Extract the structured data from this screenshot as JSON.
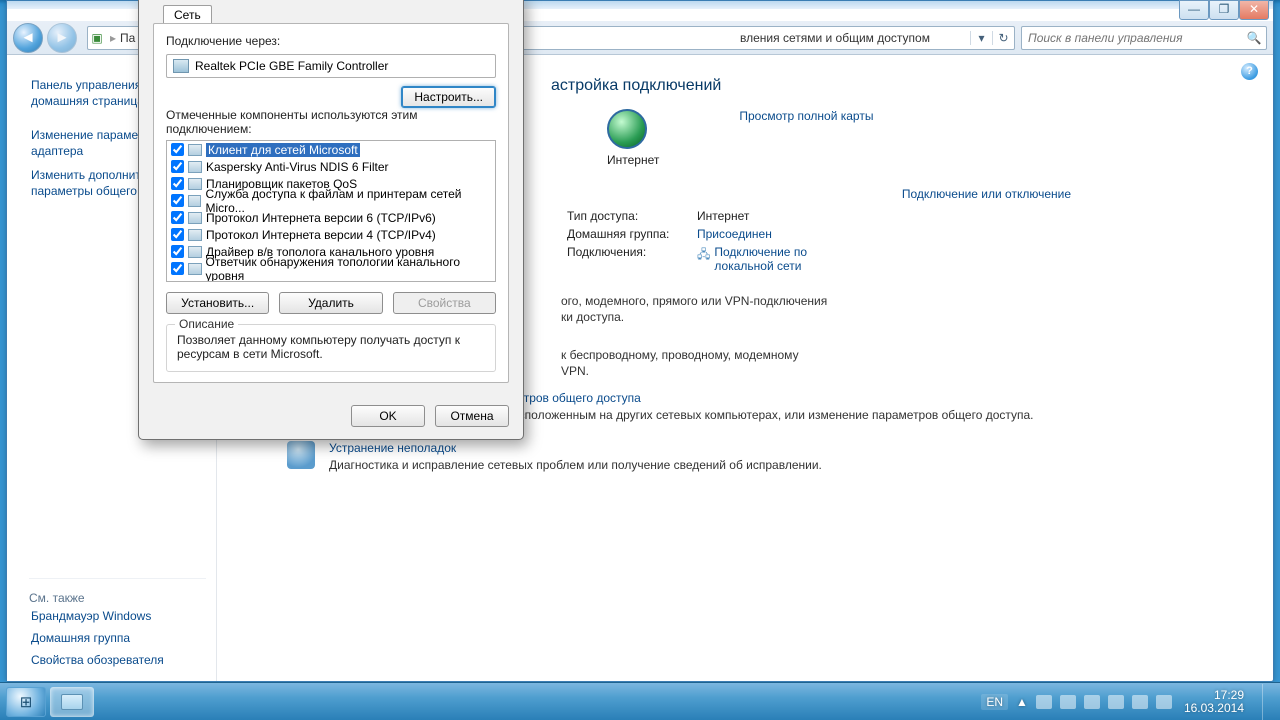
{
  "win_controls": {
    "min": "—",
    "max": "❐",
    "close": "✕"
  },
  "addr": {
    "prefix": "Па",
    "trail": "вления сетями и общим доступом",
    "search_placeholder": "Поиск в панели управления"
  },
  "sidebar": {
    "items": [
      "Панель управления — домашняя страница",
      "Изменение параметров адаптера",
      "Изменить дополнительные параметры общего доступа"
    ],
    "see_also_title": "См. также",
    "see_also": [
      "Брандмауэр Windows",
      "Домашняя группа",
      "Свойства обозревателя"
    ]
  },
  "main": {
    "title_fragment": "астройка подключений",
    "view_map": "Просмотр полной карты",
    "internet": "Интернет",
    "connect_or_disconnect": "Подключение или отключение",
    "status": {
      "access_type_k": "Тип доступа:",
      "access_type_v": "Интернет",
      "homegroup_k": "Домашняя группа:",
      "homegroup_v": "Присоединен",
      "connections_k": "Подключения:",
      "connections_v": "Подключение по локальной сети"
    },
    "line1": "ого, модемного, прямого или VPN-подключения",
    "line2": "ки доступа.",
    "line3": "к беспроводному, проводному, модемному",
    "line4": "VPN.",
    "task1_title": "Выбор домашней группы и параметров общего доступа",
    "task1_desc": "Доступ к файлам и принтерам, расположенным на других сетевых компьютерах, или изменение параметров общего доступа.",
    "task2_title": "Устранение неполадок",
    "task2_desc": "Диагностика и исправление сетевых проблем или получение сведений об исправлении."
  },
  "dialog": {
    "tab": "Сеть",
    "connect_via": "Подключение через:",
    "adapter": "Realtek PCIe GBE Family Controller",
    "configure": "Настроить...",
    "components_label": "Отмеченные компоненты используются этим подключением:",
    "components": [
      "Клиент для сетей Microsoft",
      "Kaspersky Anti-Virus NDIS 6 Filter",
      "Планировщик пакетов QoS",
      "Служба доступа к файлам и принтерам сетей Micro...",
      "Протокол Интернета версии 6 (TCP/IPv6)",
      "Протокол Интернета версии 4 (TCP/IPv4)",
      "Драйвер в/в тополога канального уровня",
      "Ответчик обнаружения топологии канального уровня"
    ],
    "install": "Установить...",
    "uninstall": "Удалить",
    "properties": "Свойства",
    "desc_title": "Описание",
    "desc_body": "Позволяет данному компьютеру получать доступ к ресурсам в сети Microsoft.",
    "ok": "OK",
    "cancel": "Отмена"
  },
  "taskbar": {
    "lang": "EN",
    "time": "17:29",
    "date": "16.03.2014",
    "chev": "▲"
  }
}
